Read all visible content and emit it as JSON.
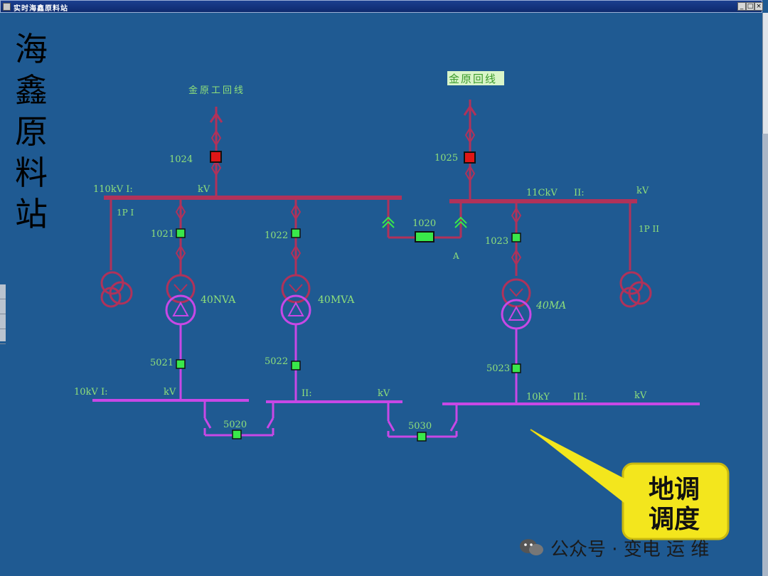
{
  "window": {
    "title": "实时海鑫原料站"
  },
  "station_name": [
    "海",
    "鑫",
    "原",
    "料",
    "站"
  ],
  "incoming": {
    "left_line": "金原工回线",
    "right_line": "金原回线",
    "left_breaker": "1024",
    "right_breaker": "1025"
  },
  "bus_110": {
    "one_label": "110kV  I:",
    "one_unit": "kV",
    "two_label": "11CkV",
    "two_num": "II:",
    "two_unit": "kV",
    "pt_one": "1P I",
    "pt_two": "1P II",
    "tie_breaker": "1020",
    "tie_tag": "A"
  },
  "feeders": [
    {
      "hv_breaker": "1021",
      "rating": "40NVA",
      "lv_breaker": "5021"
    },
    {
      "hv_breaker": "1022",
      "rating": "40MVA",
      "lv_breaker": "5022"
    },
    {
      "hv_breaker": "1023",
      "rating": "40MA",
      "lv_breaker": "5023"
    }
  ],
  "bus_10": {
    "one_label": "10kV  I:",
    "one_unit": "kV",
    "two_label": "II:",
    "two_unit": "kV",
    "three_label": "10kY",
    "three_num": "III:",
    "three_unit": "kV",
    "tie_one": "5020",
    "tie_two": "5030"
  },
  "callout": {
    "line1": "地调",
    "line2": "调度"
  },
  "watermark": "公众号 · 变电 运 维",
  "colors": {
    "background": "#1f5a92",
    "bus_110": "#b0325a",
    "bus_10": "#c848e6",
    "breaker_closed": "#39e84a",
    "breaker_alarm": "#e01616",
    "label_green": "#8fe07a",
    "callout_fill": "#f3e61d"
  }
}
